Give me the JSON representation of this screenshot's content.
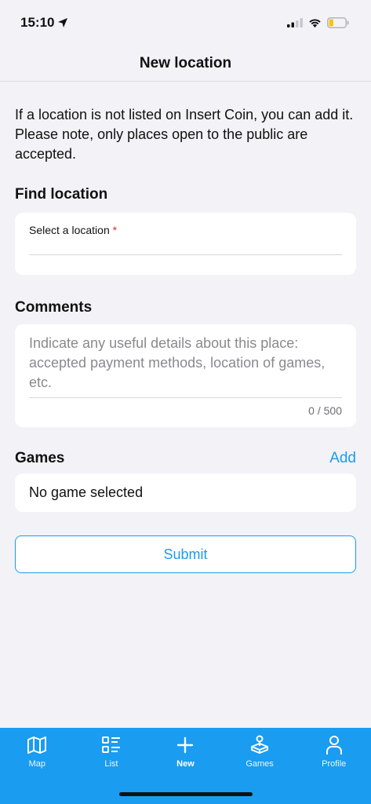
{
  "status": {
    "time": "15:10"
  },
  "header": {
    "title": "New location"
  },
  "intro": "If a location is not listed on Insert Coin, you can add it. Please note, only places open to the public are accepted.",
  "find_location": {
    "title": "Find location",
    "field_label": "Select a location",
    "required_mark": "*"
  },
  "comments": {
    "title": "Comments",
    "placeholder": "Indicate any useful details about this place: accepted payment methods, location of games, etc.",
    "counter": "0 / 500"
  },
  "games": {
    "title": "Games",
    "add_label": "Add",
    "empty_text": "No game selected"
  },
  "submit_label": "Submit",
  "tabbar": {
    "accent_color": "#1a9cf0",
    "items": [
      {
        "label": "Map",
        "icon": "map-icon"
      },
      {
        "label": "List",
        "icon": "list-icon"
      },
      {
        "label": "New",
        "icon": "plus-icon",
        "active": true
      },
      {
        "label": "Games",
        "icon": "joystick-icon"
      },
      {
        "label": "Profile",
        "icon": "profile-icon"
      }
    ]
  }
}
